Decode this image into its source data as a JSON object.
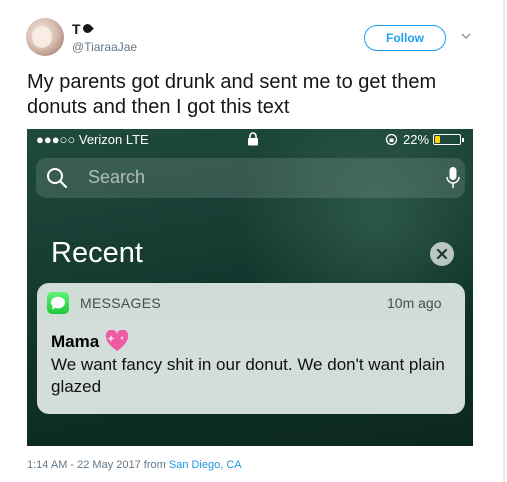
{
  "tweet": {
    "display_name": "T",
    "handle": "@TiaraaJae",
    "follow_label": "Follow",
    "text": "My parents got drunk and sent me to get them donuts and then I got this text",
    "timestamp": "1:14 AM - 22 May 2017",
    "from_label": " from ",
    "location": "San Diego, CA"
  },
  "phone": {
    "status": {
      "carrier": "●●●○○ Verizon  LTE",
      "battery_percent_label": "22%",
      "battery_level": 0.22
    },
    "search_placeholder": "Search",
    "section_title": "Recent",
    "notification": {
      "app_name": "MESSAGES",
      "time_ago": "10m ago",
      "sender": "Mama",
      "body": "We want fancy shit in our donut.   We don't want plain glazed"
    }
  },
  "colors": {
    "accent": "#1da1f2",
    "messages_green": "#1fc93a",
    "battery_yellow": "#ffd60a"
  },
  "icons": [
    "verified-mark-icon",
    "chevron-down-icon",
    "lock-icon",
    "rotation-lock-icon",
    "battery-icon",
    "search-icon",
    "mic-icon",
    "clear-icon",
    "messages-app-icon",
    "heart-emoji-icon"
  ]
}
